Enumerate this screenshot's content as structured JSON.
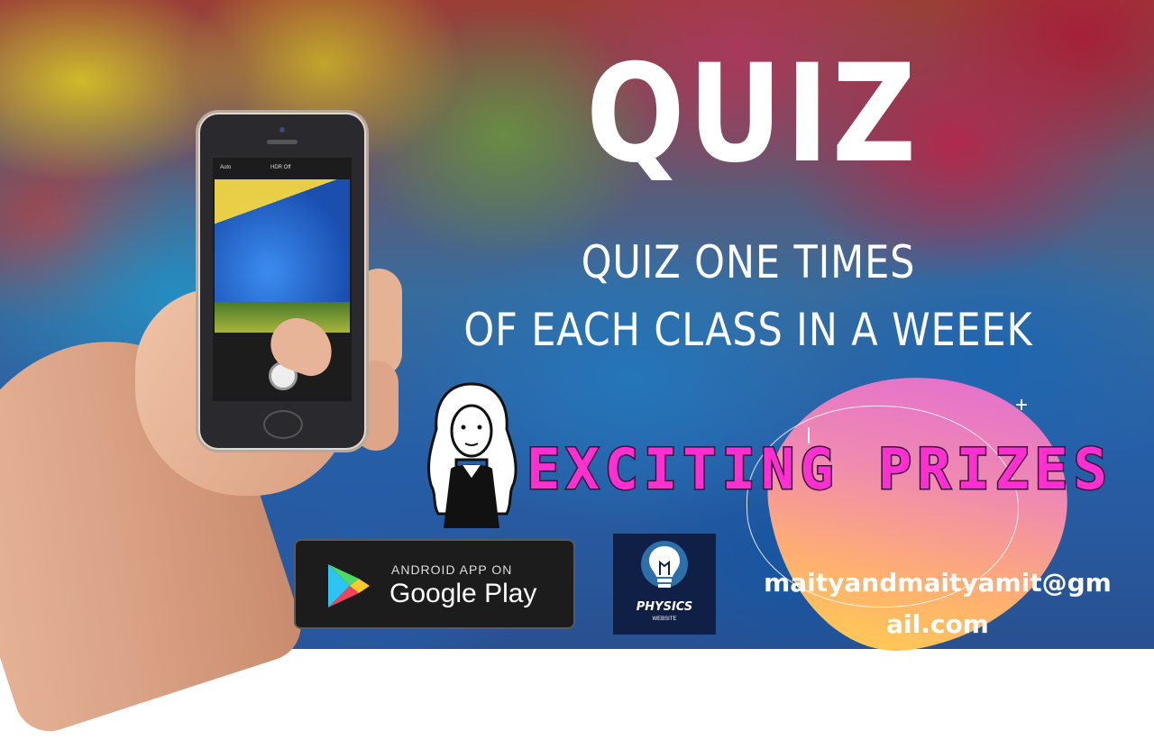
{
  "title": "QUIZ",
  "subtitle": {
    "line1": "QUIZ ONE TIMES",
    "line2": "OF EACH CLASS IN A WEEEK"
  },
  "prizes_text": "EXCITING PRIZES",
  "google_play": {
    "small_label": "ANDROID APP ON",
    "big_label": "Google Play"
  },
  "logo": {
    "name": "PHYSICS",
    "tagline": "WEBSITE"
  },
  "phone": {
    "flash": "Auto",
    "hdr": "HDR Off"
  },
  "email": "maityandmaityamit@gmail.com",
  "colors": {
    "prizes": "#ff2fd0",
    "logo_bg": "#101f45"
  }
}
